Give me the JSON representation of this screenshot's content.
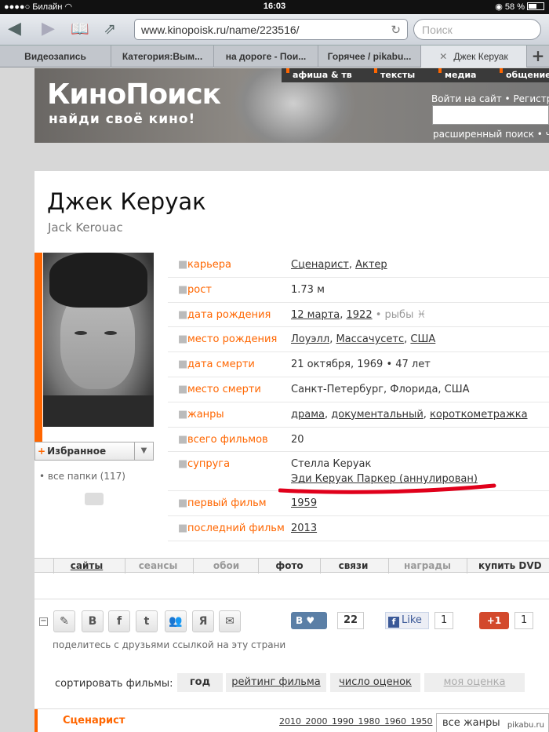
{
  "status": {
    "carrier": "Билайн",
    "time": "16:03",
    "battery": "58 %"
  },
  "browser": {
    "url": "www.kinopoisk.ru/name/223516/",
    "search_placeholder": "Поиск"
  },
  "tabs": [
    "Видеозапись",
    "Категория:Вым...",
    "на дороге - Пои...",
    "Горячее / pikabu...",
    "Джек Керуак"
  ],
  "site": {
    "logo": "КиноПоиск",
    "slogan": "найди своё кино!",
    "menu": [
      "афиша & тв",
      "тексты",
      "медиа",
      "общение"
    ],
    "login": "Войти на сайт • Регистр",
    "advanced_search": "расширенный поиск • ч"
  },
  "person": {
    "name": "Джек Керуак",
    "original_name": "Jack Kerouac",
    "favorites_label": "Избранное",
    "folders": "все папки (117)",
    "info": [
      {
        "label": "карьера",
        "parts": [
          "Сценарист",
          ", ",
          "Актер"
        ]
      },
      {
        "label": "рост",
        "value": "1.73 м"
      },
      {
        "label": "дата рождения",
        "parts": [
          "12 марта",
          ", ",
          "1922",
          " • рыбы ♓"
        ]
      },
      {
        "label": "место рождения",
        "parts": [
          "Лоуэлл",
          ", ",
          "Массачусетс",
          ", ",
          "США"
        ]
      },
      {
        "label": "дата смерти",
        "value": "21 октября, 1969 • 47 лет"
      },
      {
        "label": "место смерти",
        "value": "Санкт-Петербург, Флорида, США"
      },
      {
        "label": "жанры",
        "parts": [
          "драма",
          ", ",
          "документальный",
          ", ",
          "короткометражка"
        ]
      },
      {
        "label": "всего фильмов",
        "value": "20"
      },
      {
        "label": "супруга",
        "value": "Стелла Керуак",
        "value2": "Эди Керуак Паркер (аннулирован)"
      },
      {
        "label": "первый фильм",
        "parts": [
          "1959"
        ]
      },
      {
        "label": "последний фильм",
        "parts": [
          "2013"
        ]
      }
    ]
  },
  "page_tabs": [
    "сайты",
    "сеансы",
    "обои",
    "фото",
    "связи",
    "награды",
    "купить DVD"
  ],
  "share": {
    "text": "поделитесь с друзьями ссылкой на эту страни",
    "vk_count": "22",
    "fb_label": "Like",
    "fb_count": "1",
    "gplus_label": "+1",
    "gplus_count": "1"
  },
  "sort": {
    "label": "сортировать фильмы:",
    "options": [
      "год",
      "рейтинг фильма",
      "число оценок",
      "моя оценка"
    ]
  },
  "career_section": {
    "title": "Сценарист",
    "years": [
      "2010",
      "2000",
      "1990",
      "1980",
      "1960",
      "1950"
    ],
    "genres_select": "все жанры"
  },
  "watermark": "pikabu.ru"
}
